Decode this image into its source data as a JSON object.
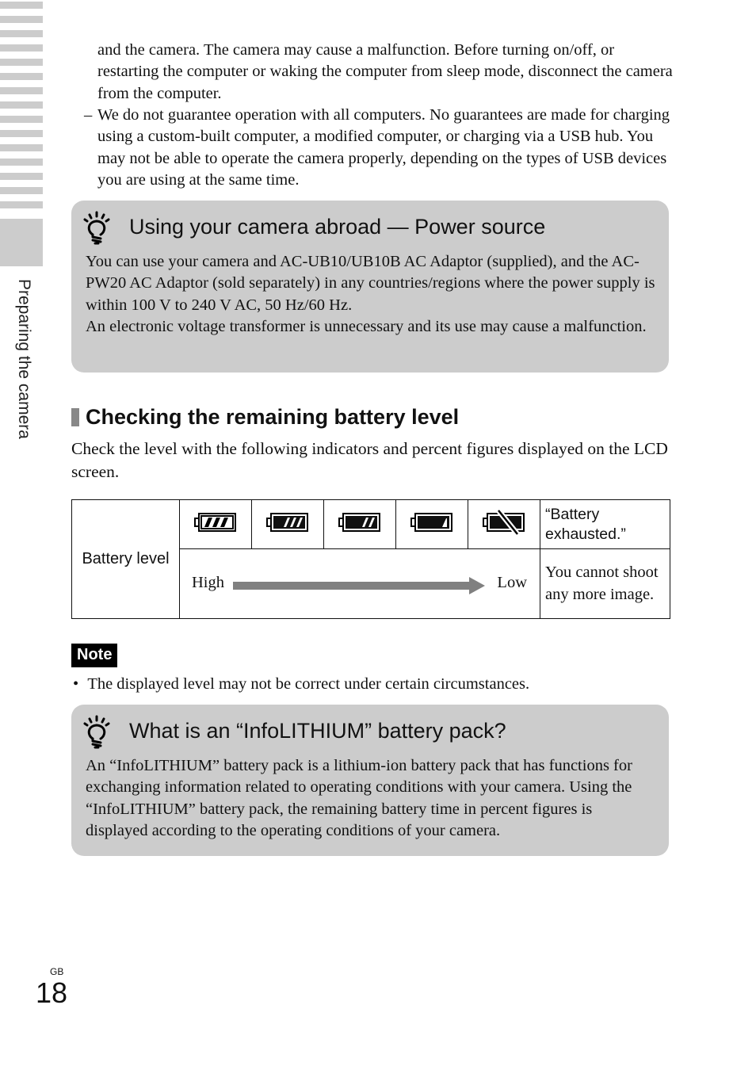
{
  "side_tab": {
    "label": "Preparing the camera"
  },
  "continuation": {
    "text": "and the camera. The camera may cause a malfunction. Before turning on/off, or restarting the computer or waking the computer from sleep mode, disconnect the camera from the computer."
  },
  "dash_item": {
    "marker": "–",
    "text": "We do not guarantee operation with all computers. No guarantees are made for charging using a custom-built computer, a modified computer, or charging via a USB hub. You may not be able to operate the camera properly, depending on the types of USB devices you are using at the same time."
  },
  "tip_abroad": {
    "icon": "lightbulb-icon",
    "title": "Using your camera abroad — Power source",
    "lines": [
      "You can use your camera and AC-UB10/UB10B AC Adaptor (supplied), and the AC-PW20 AC Adaptor (sold separately) in any countries/regions where the power supply is within 100 V to 240 V AC, 50 Hz/60 Hz.",
      "An electronic voltage transformer is unnecessary and its use may cause a malfunction."
    ]
  },
  "battery_section": {
    "heading": "Checking the remaining battery level",
    "intro": "Check the level with the following indicators and percent figures displayed on the LCD screen.",
    "table": {
      "row_label": "Battery level",
      "indicators": [
        {
          "icon": "battery-full-icon",
          "bars": 3,
          "fill": "empty"
        },
        {
          "icon": "battery-three-bars-icon",
          "bars": 3,
          "fill": "dark"
        },
        {
          "icon": "battery-two-bars-icon",
          "bars": 2,
          "fill": "dark"
        },
        {
          "icon": "battery-one-bar-icon",
          "bars": 1,
          "fill": "dark"
        },
        {
          "icon": "battery-exhausted-icon",
          "bars": 0,
          "fill": "dark"
        }
      ],
      "exhausted_message": "“Battery exhausted.”",
      "range_high": "High",
      "range_low": "Low",
      "exhausted_description": "You cannot shoot any more image."
    }
  },
  "note": {
    "badge": "Note",
    "bullet": "•",
    "text": "The displayed level may not be correct under certain circumstances."
  },
  "tip_infolithium": {
    "icon": "lightbulb-icon",
    "title": "What is an “InfoLITHIUM” battery pack?",
    "text": "An “InfoLITHIUM” battery pack is a lithium-ion battery pack that has functions for exchanging information related to operating conditions with your camera. Using the “InfoLITHIUM” battery pack, the remaining battery time in percent figures is displayed according to the operating conditions of your camera."
  },
  "footer": {
    "region": "GB",
    "page_number": "18"
  },
  "colors": {
    "tip_background": "#cccccc",
    "side_stripe": "#cccccc",
    "section_marker": "#888888",
    "arrow": "#808080"
  }
}
